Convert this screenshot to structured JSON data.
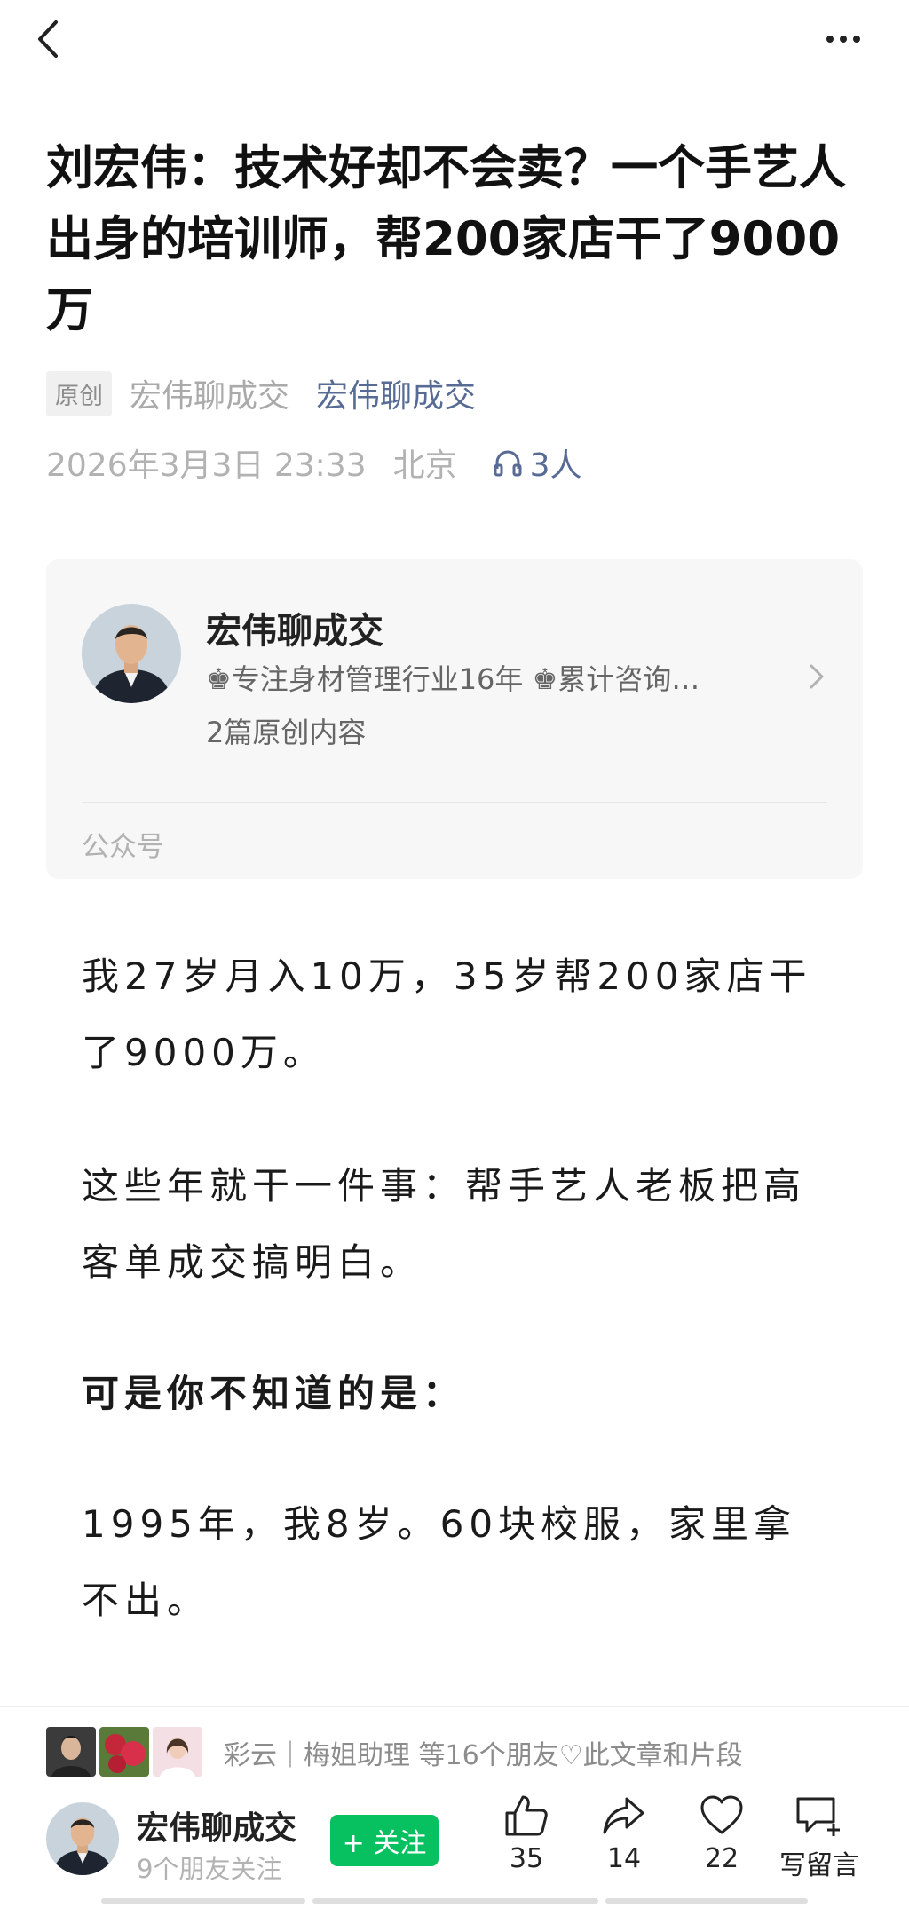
{
  "top_bar": {
    "back_icon": "chevron-left-icon",
    "more_icon": "more-dots-icon"
  },
  "article": {
    "title": "刘宏伟：技术好却不会卖？一个手艺人出身的培训师，帮200家店干了9000万",
    "original_badge": "原创",
    "author": "宏伟聊成交",
    "account_link": "宏伟聊成交",
    "date": "2026年3月3日 23:33",
    "location": "北京",
    "listen_count": "3人"
  },
  "account_card": {
    "name": "宏伟聊成交",
    "description": "♚专注身材管理行业16年 ♚累计咨询…",
    "original_count": "2篇原创内容",
    "type": "公众号"
  },
  "body": {
    "p1": "我27岁月入10万，35岁帮200家店干了9000万。",
    "p2": "这些年就干一件事：帮手艺人老板把高客单成交搞明白。",
    "p3": "可是你不知道的是：",
    "p4": "1995年，我8岁。60块校服，家里拿不出。"
  },
  "friends_bar": {
    "text": "彩云｜梅姐助理 等16个朋友♡此文章和片段"
  },
  "bottom_bar": {
    "name": "宏伟聊成交",
    "followers": "9个朋友关注",
    "follow_label": "+ 关注",
    "like_count": "35",
    "share_count": "14",
    "favorite_count": "22",
    "comment_label": "写留言"
  },
  "colors": {
    "accent_green": "#07c160",
    "link_blue": "#576b95"
  }
}
